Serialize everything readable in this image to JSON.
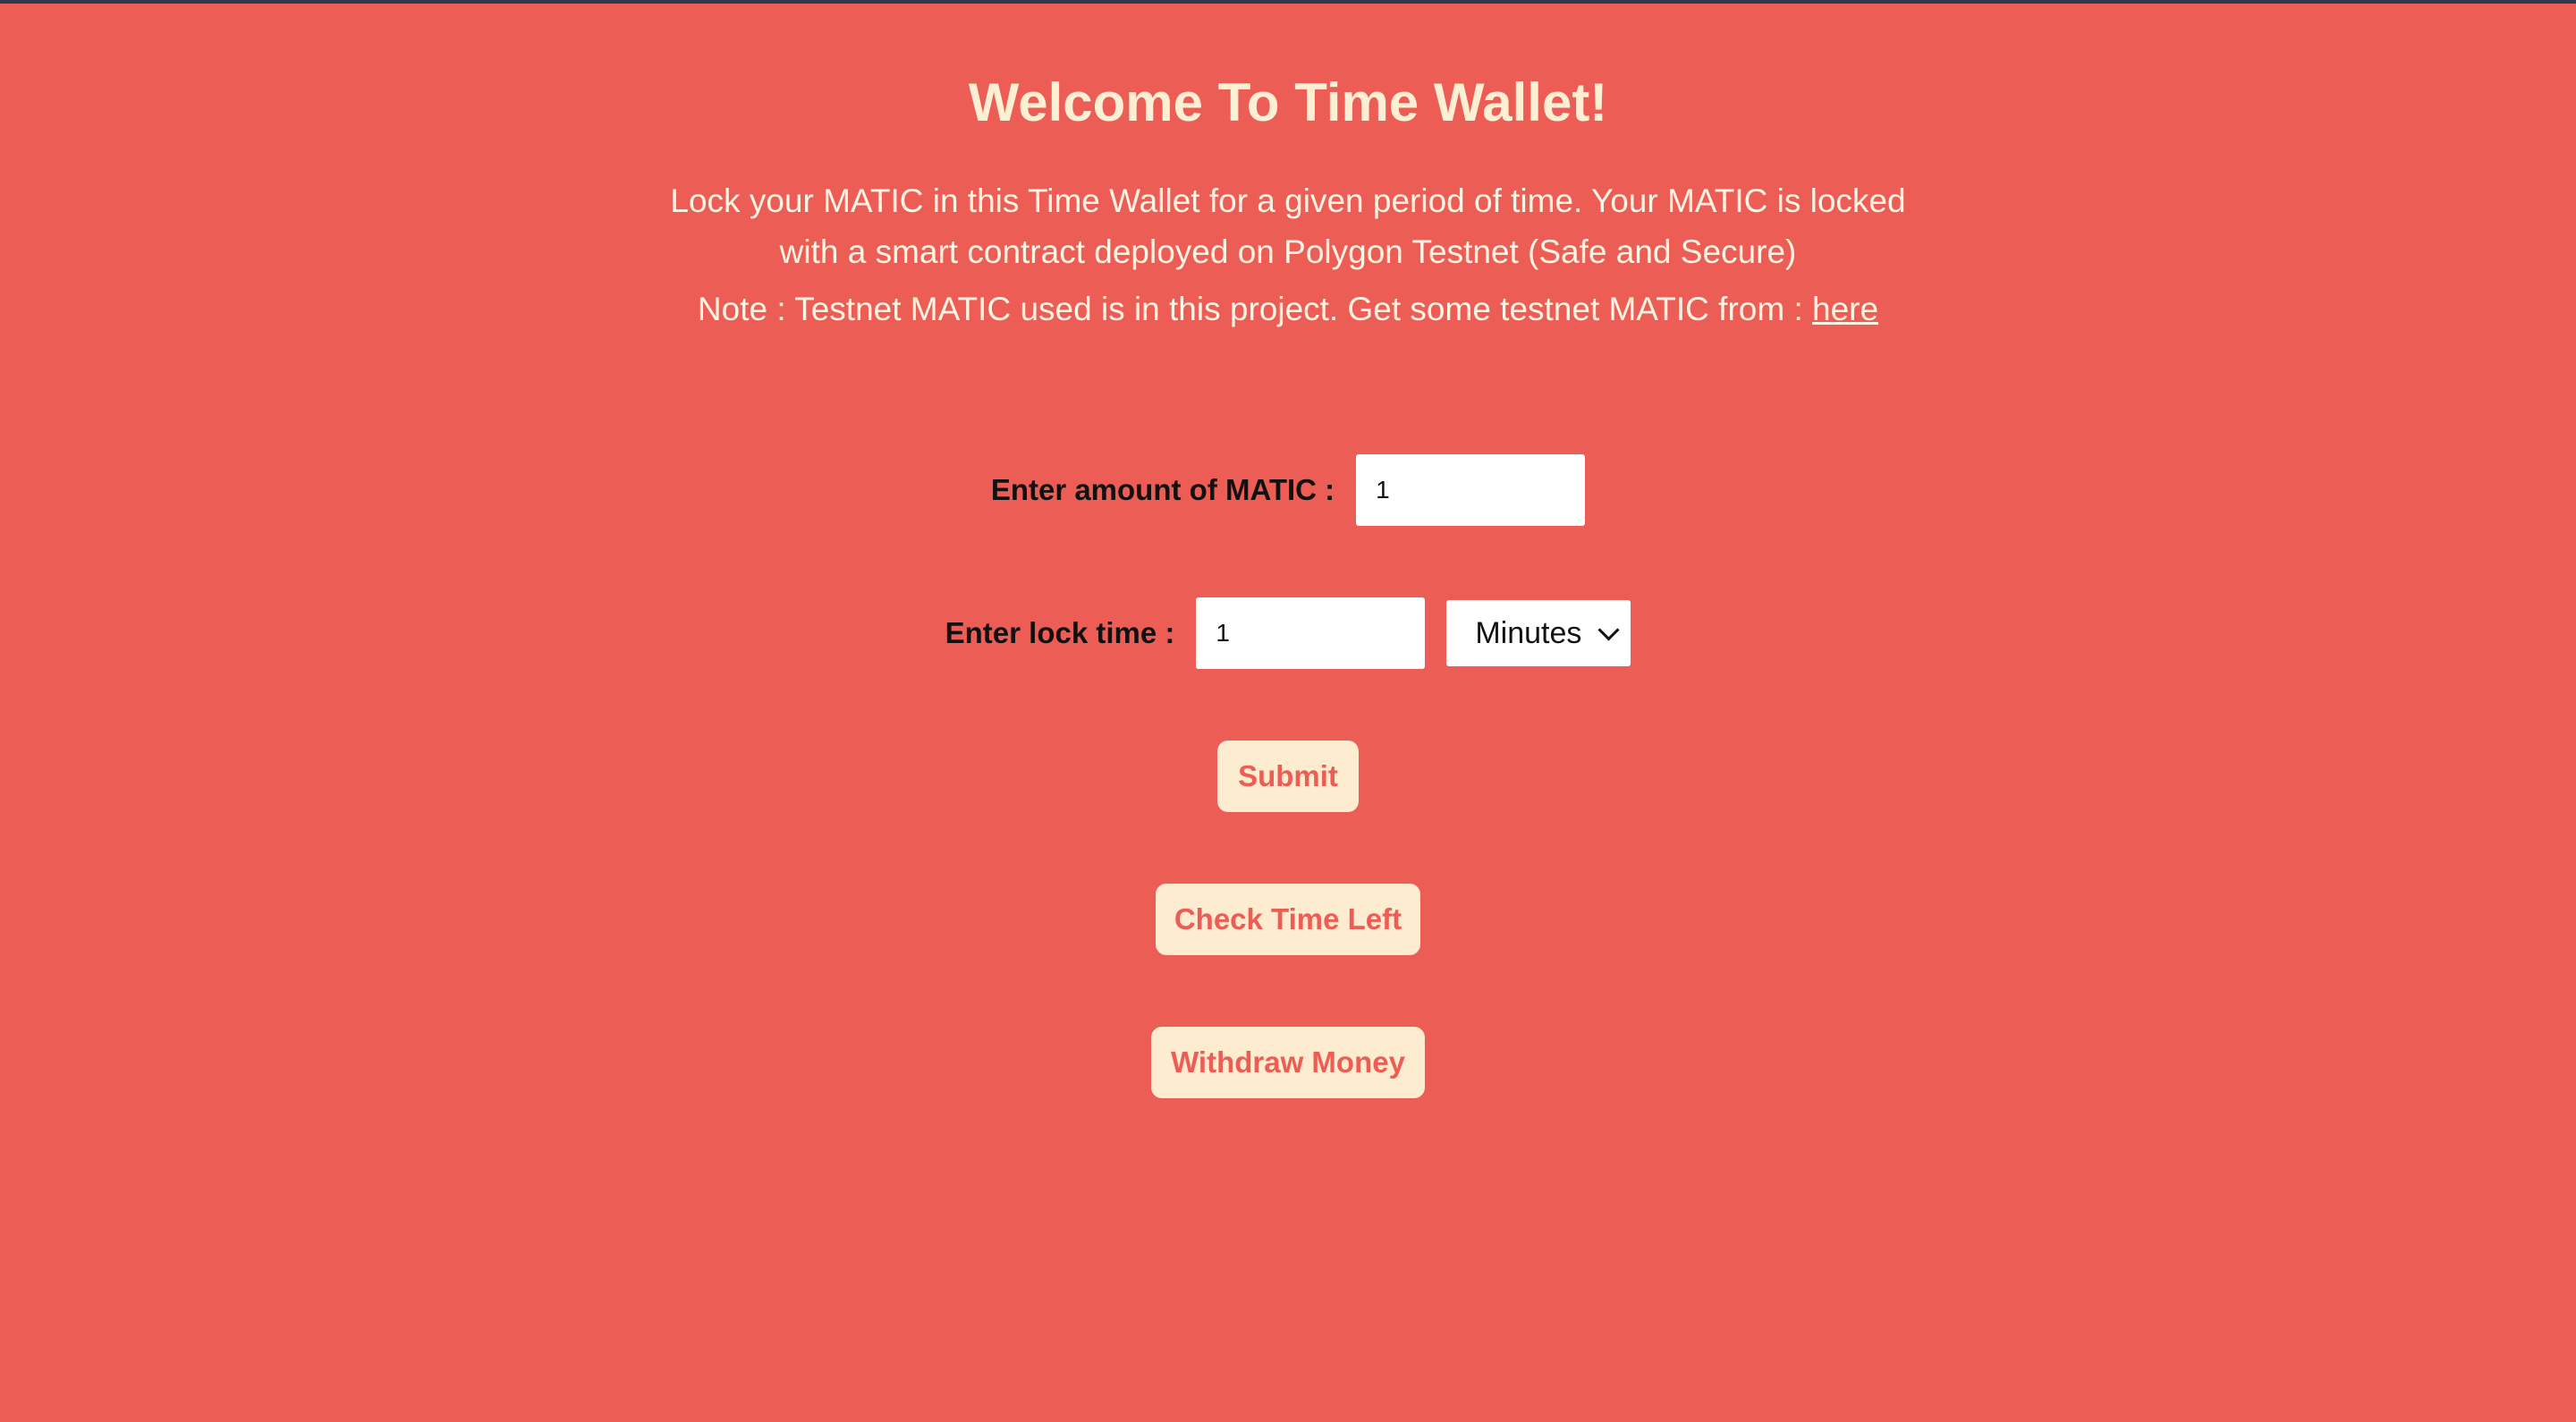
{
  "header": {
    "title": "Welcome To Time Wallet!"
  },
  "intro": {
    "text": "Lock your MATIC in this Time Wallet for a given period of time. Your MATIC is locked with a smart contract deployed on Polygon Testnet (Safe and Secure)"
  },
  "note": {
    "text": "Note : Testnet MATIC used is in this project. Get some testnet MATIC from : ",
    "link_text": "here"
  },
  "form": {
    "amount_label": "Enter amount of MATIC :",
    "amount_value": "1",
    "lock_label": "Enter lock time :",
    "lock_value": "1",
    "unit_selected": "Minutes"
  },
  "buttons": {
    "submit": "Submit",
    "check_time_left": "Check Time Left",
    "withdraw": "Withdraw Money"
  },
  "colors": {
    "background": "#ec5e55",
    "accent_text": "#fcefd3",
    "button_bg": "#fdeccf"
  }
}
